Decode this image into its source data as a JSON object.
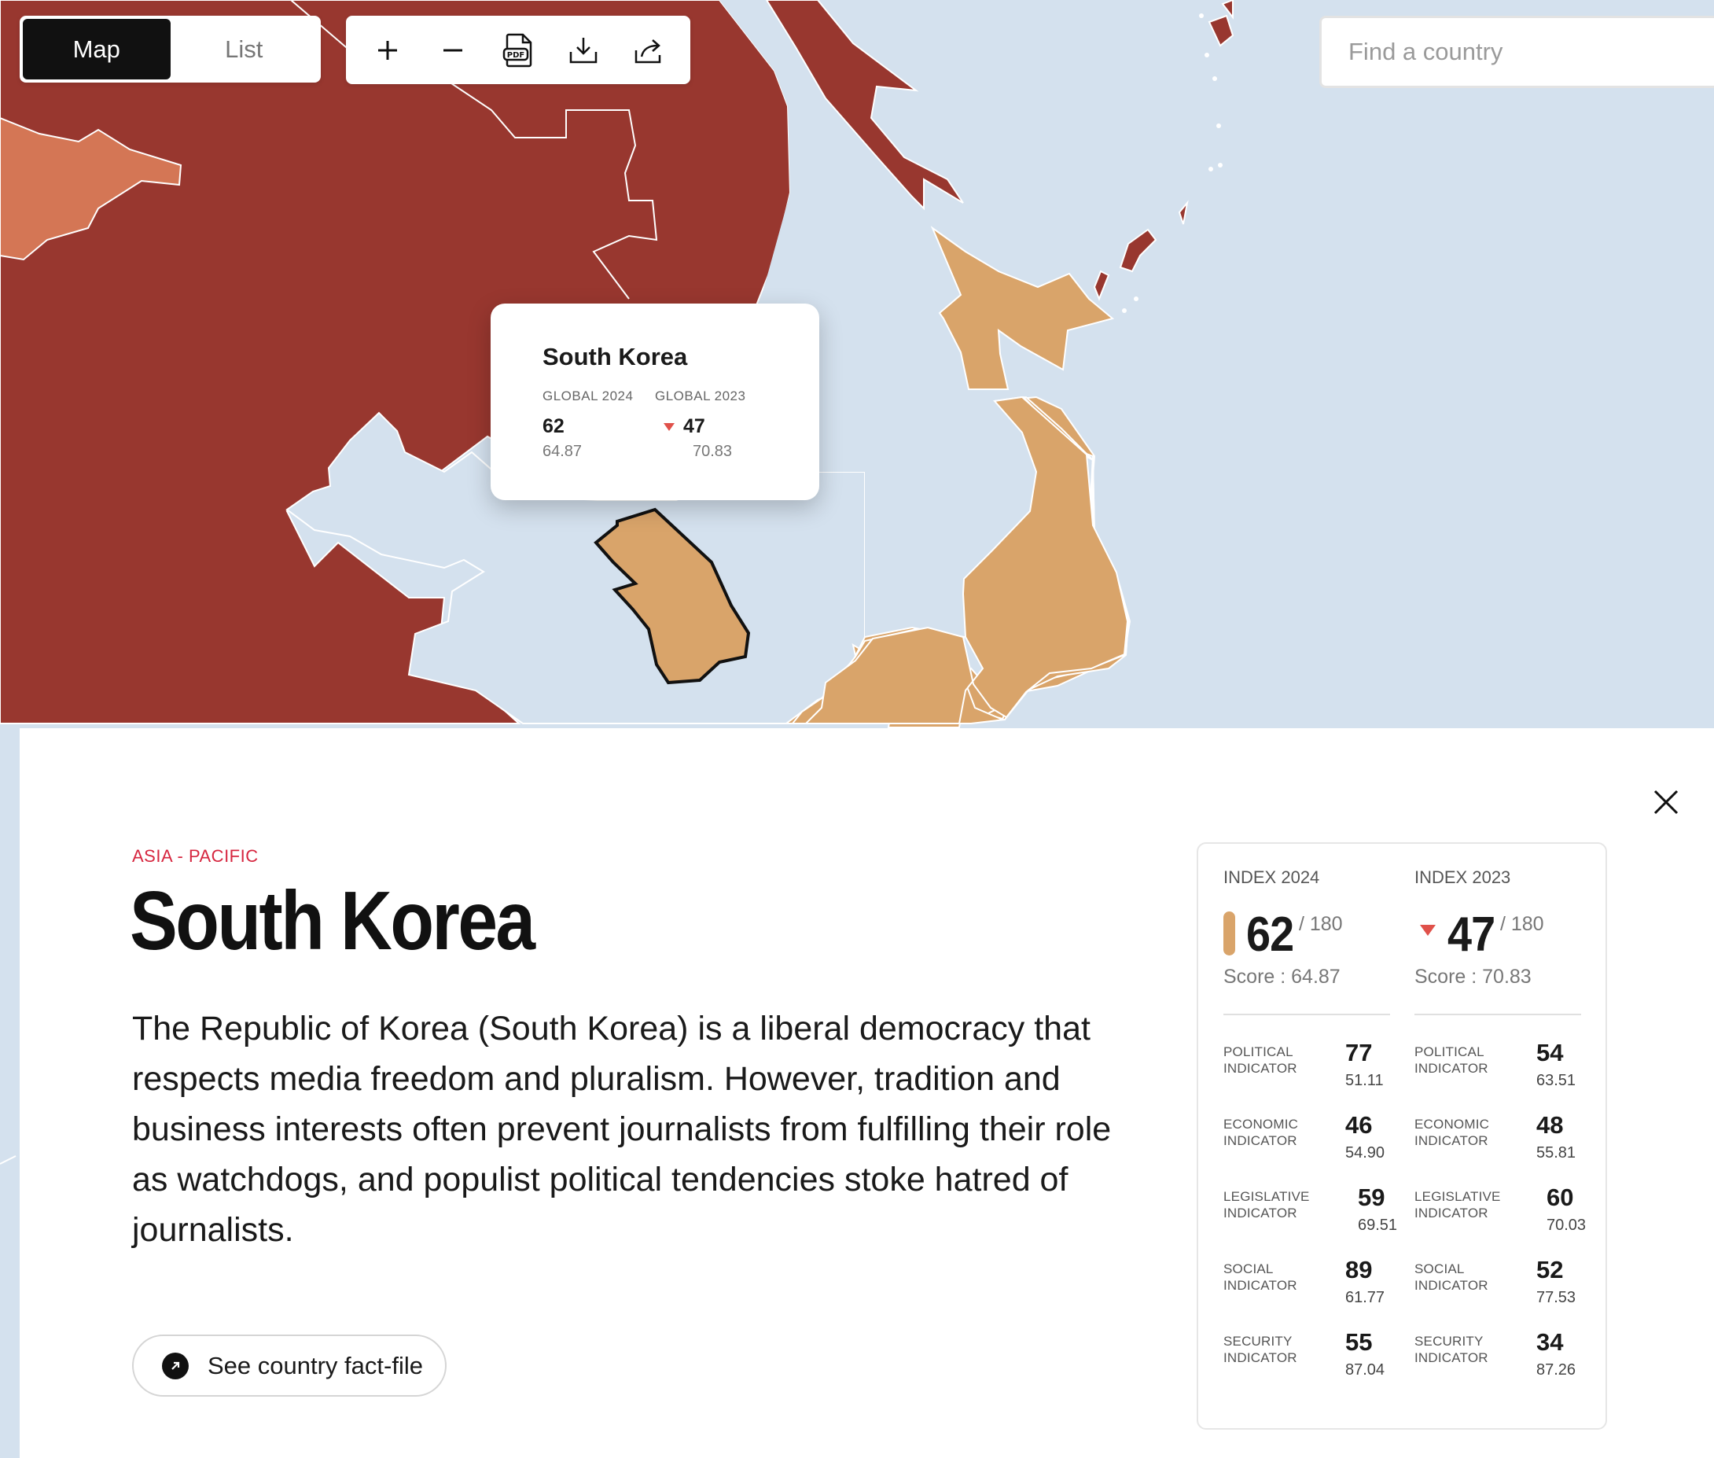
{
  "view_toggle": {
    "map_label": "Map",
    "list_label": "List",
    "active": "Map"
  },
  "toolbar": {
    "buttons": [
      {
        "name": "zoom-in",
        "icon": "plus-icon"
      },
      {
        "name": "zoom-out",
        "icon": "minus-icon"
      },
      {
        "name": "download-pdf",
        "icon": "pdf-icon",
        "icon_text": "PDF"
      },
      {
        "name": "download",
        "icon": "download-icon"
      },
      {
        "name": "share",
        "icon": "share-icon"
      }
    ]
  },
  "search": {
    "placeholder": "Find a country",
    "value": ""
  },
  "map": {
    "colors": {
      "water": "#d4e1ee",
      "very_serious": "#98372f",
      "difficult": "#d47655",
      "problematic": "#d9a46a",
      "border": "#ffffff"
    },
    "selected_country": "South Korea"
  },
  "tooltip": {
    "country": "South Korea",
    "col1": {
      "label": "GLOBAL 2024",
      "rank": "62",
      "score": "64.87"
    },
    "col2": {
      "label": "GLOBAL 2023",
      "rank": "47",
      "score": "70.83",
      "trend": "down"
    }
  },
  "panel": {
    "region": "ASIA - PACIFIC",
    "title": "South Korea",
    "description": "The Republic of Korea (South Korea) is a liberal democracy that respects media freedom and pluralism. However, tradition and business interests often prevent journalists from fulfilling their role as watchdogs, and populist political tendencies stoke hatred of journalists.",
    "fact_file_label": "See country fact-file",
    "scorecard": {
      "y2024": {
        "label": "INDEX 2024",
        "rank": "62",
        "of": "/ 180",
        "score": "Score : 64.87",
        "indicators": [
          {
            "label": "POLITICAL INDICATOR",
            "rank": "77",
            "score": "51.11"
          },
          {
            "label": "ECONOMIC INDICATOR",
            "rank": "46",
            "score": "54.90"
          },
          {
            "label": "LEGISLATIVE INDICATOR",
            "rank": "59",
            "score": "69.51"
          },
          {
            "label": "SOCIAL INDICATOR",
            "rank": "89",
            "score": "61.77"
          },
          {
            "label": "SECURITY INDICATOR",
            "rank": "55",
            "score": "87.04"
          }
        ]
      },
      "y2023": {
        "label": "INDEX 2023",
        "rank": "47",
        "of": "/ 180",
        "score": "Score : 70.83",
        "trend": "down",
        "indicators": [
          {
            "label": "POLITICAL INDICATOR",
            "rank": "54",
            "score": "63.51"
          },
          {
            "label": "ECONOMIC INDICATOR",
            "rank": "48",
            "score": "55.81"
          },
          {
            "label": "LEGISLATIVE INDICATOR",
            "rank": "60",
            "score": "70.03"
          },
          {
            "label": "SOCIAL INDICATOR",
            "rank": "52",
            "score": "77.53"
          },
          {
            "label": "SECURITY INDICATOR",
            "rank": "34",
            "score": "87.26"
          }
        ]
      }
    }
  }
}
